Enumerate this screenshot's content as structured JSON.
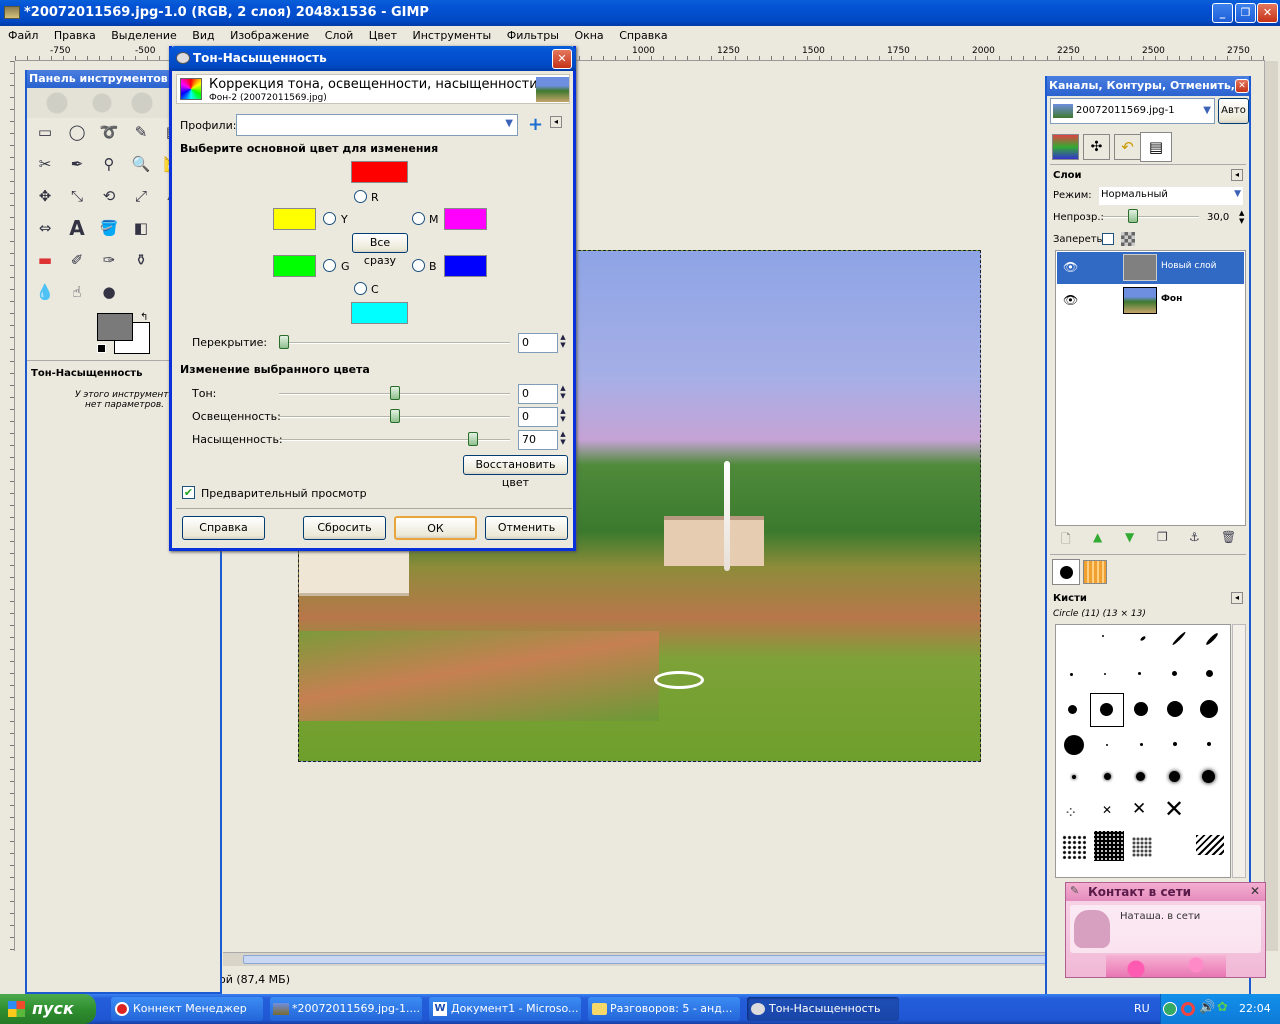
{
  "window": {
    "title": "*20072011569.jpg-1.0 (RGB, 2 слоя) 2048x1536 - GIMP",
    "buttons": [
      "_",
      "❐",
      "✕"
    ]
  },
  "menu": [
    "Файл",
    "Правка",
    "Выделение",
    "Вид",
    "Изображение",
    "Слой",
    "Цвет",
    "Инструменты",
    "Фильтры",
    "Окна",
    "Справка"
  ],
  "ruler": {
    "marks": [
      "-750",
      "-500",
      "1000",
      "1250",
      "1500",
      "1750",
      "2000",
      "2250",
      "2500",
      "2750"
    ]
  },
  "toolbox": {
    "title": "Панель инструментов ...",
    "options_title": "Тон-Насыщенность",
    "options_text": "У этого инструмента нет параметров."
  },
  "dialog": {
    "title": "Тон-Насыщенность",
    "heading": "Коррекция тона, освещенности, насыщенности",
    "subheading": "Фон-2 (20072011569.jpg)",
    "profiles_label": "Профили:",
    "section1": "Выберите основной цвет для изменения",
    "colors": {
      "r": "R",
      "y": "Y",
      "m": "M",
      "g": "G",
      "b": "B",
      "c": "C",
      "all": "Все сразу"
    },
    "overlap_label": "Перекрытие:",
    "overlap_value": "0",
    "section2": "Изменение выбранного цвета",
    "hue_label": "Тон:",
    "hue_value": "0",
    "light_label": "Освещенность:",
    "light_value": "0",
    "sat_label": "Насыщенность:",
    "sat_value": "70",
    "restore": "Восстановить цвет",
    "preview": "Предварительный просмотр",
    "help": "Справка",
    "reset": "Сбросить",
    "ok": "ОК",
    "cancel": "Отменить",
    "swatch_colors": {
      "r": "#ff0000",
      "y": "#ffff00",
      "m": "#ff00ff",
      "g": "#00ff00",
      "b": "#0000ff",
      "c": "#00ffff"
    }
  },
  "right_panel": {
    "title": "Каналы, Контуры, Отменить, ...",
    "image_select": "20072011569.jpg-1",
    "auto": "Авто",
    "layers_title": "Слои",
    "mode_label": "Режим:",
    "mode_value": "Нормальный",
    "opacity_label": "Непрозр.:",
    "opacity_value": "30,0",
    "lock_label": "Запереть:",
    "layers": [
      {
        "name": "Новый слой"
      },
      {
        "name": "Фон"
      }
    ],
    "brushes_title": "Кисти",
    "brush_name": "Circle (11) (13 × 13)"
  },
  "status": {
    "text": "ой (87,4 МБ)"
  },
  "notification": {
    "title": "Контакт в сети",
    "text": "Наташа. в сети"
  },
  "taskbar": {
    "start": "пуск",
    "items": [
      "Коннект Менеджер",
      "*20072011569.jpg-1....",
      "Документ1 - Microso...",
      "Разговоров: 5 - анд...",
      "Тон-Насыщенность"
    ],
    "lang": "RU",
    "clock": "22:04"
  }
}
